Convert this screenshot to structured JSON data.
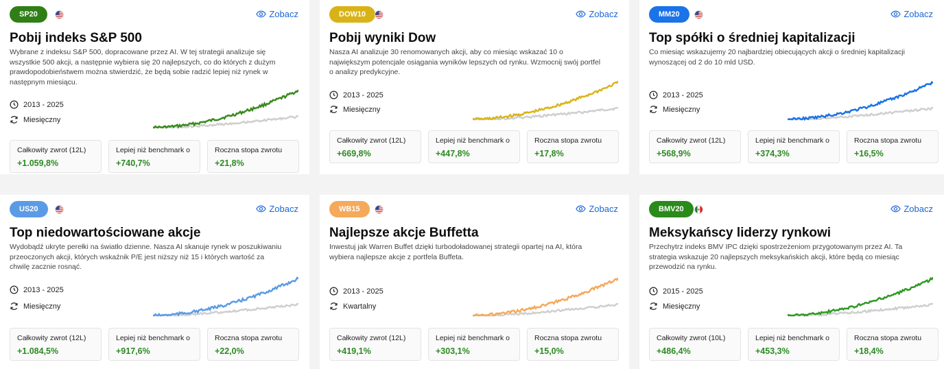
{
  "view_label": "Zobacz",
  "cards": [
    {
      "badge": "SP20",
      "badge_color": "#2f7f16",
      "flag": "us",
      "title": "Pobij indeks S&P 500",
      "description": "Wybrane z indeksu S&P 500, dopracowane przez AI. W tej strategii analizuje się wszystkie 500 akcji, a następnie wybiera się 20 najlepszych, co do których z dużym prawdopodobieństwem można stwierdzić, że będą sobie radzić lepiej niż rynek w następnym miesiącu.",
      "period": "2013 - 2025",
      "frequency": "Miesięczny",
      "line_color": "#3a8a1e",
      "stats": [
        {
          "label": "Całkowity zwrot (12L)",
          "value": "+1.059,8%"
        },
        {
          "label": "Lepiej niż benchmark o",
          "value": "+740,7%"
        },
        {
          "label": "Roczna stopa zwrotu",
          "value": "+21,8%"
        }
      ]
    },
    {
      "badge": "DOW10",
      "badge_color": "#d9b316",
      "flag": "us",
      "title": "Pobij wyniki Dow",
      "description": "Nasza AI analizuje 30 renomowanych akcji, aby co miesiąc wskazać 10 o największym potencjale osiągania wyników lepszych od rynku. Wzmocnij swój portfel o analizy predykcyjne.",
      "period": "2013 - 2025",
      "frequency": "Miesięczny",
      "line_color": "#d8b51b",
      "stats": [
        {
          "label": "Całkowity zwrot (12L)",
          "value": "+669,8%"
        },
        {
          "label": "Lepiej niż benchmark o",
          "value": "+447,8%"
        },
        {
          "label": "Roczna stopa zwrotu",
          "value": "+17,8%"
        }
      ]
    },
    {
      "badge": "MM20",
      "badge_color": "#1a73e8",
      "flag": "us",
      "title": "Top spółki o średniej kapitalizacji",
      "description": "Co miesiąc wskazujemy 20 najbardziej obiecujących akcji o średniej kapitalizacji wynoszącej od 2 do 10 mld USD.",
      "period": "2013 - 2025",
      "frequency": "Miesięczny",
      "line_color": "#1a73e8",
      "stats": [
        {
          "label": "Całkowity zwrot (12L)",
          "value": "+568,9%"
        },
        {
          "label": "Lepiej niż benchmark o",
          "value": "+374,3%"
        },
        {
          "label": "Roczna stopa zwrotu",
          "value": "+16,5%"
        }
      ]
    },
    {
      "badge": "US20",
      "badge_color": "#5b9be6",
      "flag": "us",
      "title": "Top niedowartościowane akcje",
      "description": "Wydobądź ukryte perełki na światło dzienne. Nasza AI skanuje rynek w poszukiwaniu przeoczonych akcji, których wskaźnik P/E jest niższy niż 15 i których wartość za chwilę zacznie rosnąć.",
      "period": "2013 - 2025",
      "frequency": "Miesięczny",
      "line_color": "#5b9be6",
      "stats": [
        {
          "label": "Całkowity zwrot (12L)",
          "value": "+1.084,5%"
        },
        {
          "label": "Lepiej niż benchmark o",
          "value": "+917,6%"
        },
        {
          "label": "Roczna stopa zwrotu",
          "value": "+22,0%"
        }
      ]
    },
    {
      "badge": "WB15",
      "badge_color": "#f5a95a",
      "flag": "us",
      "title": "Najlepsze akcje Buffetta",
      "description": "Inwestuj jak Warren Buffet dzięki turbodoładowanej strategii opartej na AI, która wybiera najlepsze akcje z portfela Buffeta.",
      "period": "2013 - 2025",
      "frequency": "Kwartalny",
      "line_color": "#f5a95a",
      "stats": [
        {
          "label": "Całkowity zwrot (12L)",
          "value": "+419,1%"
        },
        {
          "label": "Lepiej niż benchmark o",
          "value": "+303,1%"
        },
        {
          "label": "Roczna stopa zwrotu",
          "value": "+15,0%"
        }
      ]
    },
    {
      "badge": "BMV20",
      "badge_color": "#2a8a1a",
      "flag": "mx",
      "title": "Meksykańscy liderzy rynkowi",
      "description": "Przechytrz indeks BMV IPC dzięki spostrzeżeniom przygotowanym przez AI. Ta strategia wskazuje 20 najlepszych meksykańskich akcji, które będą co miesiąc przewodzić na rynku.",
      "period": "2015 - 2025",
      "frequency": "Miesięczny",
      "line_color": "#2e9a22",
      "stats": [
        {
          "label": "Całkowity zwrot (10L)",
          "value": "+486,4%"
        },
        {
          "label": "Lepiej niż benchmark o",
          "value": "+453,3%"
        },
        {
          "label": "Roczna stopa zwrotu",
          "value": "+18,4%"
        }
      ]
    }
  ]
}
